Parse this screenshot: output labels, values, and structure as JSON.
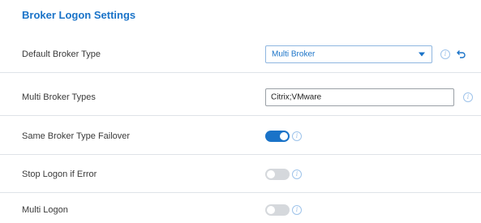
{
  "section_title": "Broker Logon Settings",
  "rows": [
    {
      "label": "Default Broker Type",
      "control": "select",
      "value": "Multi Broker",
      "info_icon": "info-icon",
      "undo_icon": "undo-icon"
    },
    {
      "label": "Multi Broker Types",
      "control": "text",
      "value": "Citrix;VMware",
      "info_icon": "info-icon"
    },
    {
      "label": "Same Broker Type Failover",
      "control": "toggle",
      "enabled": true,
      "info_icon": "info-icon"
    },
    {
      "label": "Stop Logon if Error",
      "control": "toggle",
      "enabled": false,
      "info_icon": "info-icon"
    },
    {
      "label": "Multi Logon",
      "control": "toggle",
      "enabled": false,
      "info_icon": "info-icon"
    }
  ],
  "colors": {
    "accent": "#1a73c8",
    "toggle_off": "#d5d8dc",
    "info": "#9ec3ea",
    "divider": "#dfe3e8"
  }
}
